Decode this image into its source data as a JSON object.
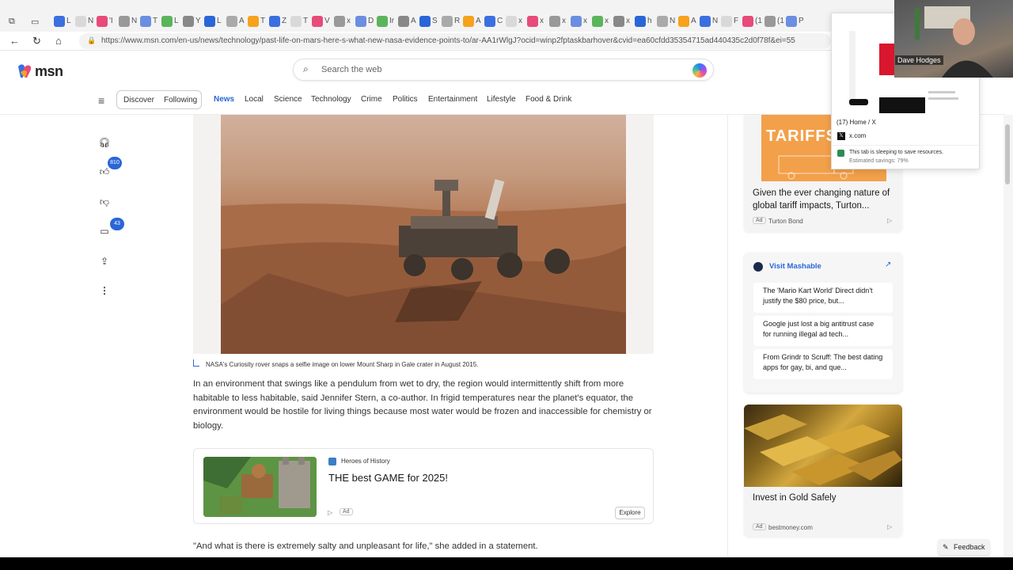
{
  "browser": {
    "url": "https://www.msn.com/en-us/news/technology/past-life-on-mars-here-s-what-new-nasa-evidence-points-to/ar-AA1rWlgJ?ocid=winp2fptaskbarhover&cvid=ea60cfdd35354715ad440435c2d0f78f&ei=55",
    "tab_labels": [
      "L",
      "N",
      "'I",
      "N",
      "T",
      "L",
      "Y",
      "L",
      "A",
      "T",
      "Z",
      "T",
      "V",
      "x",
      "D",
      "Ir",
      "A",
      "S",
      "R",
      "A",
      "C",
      "x",
      "x",
      "x",
      "x",
      "x",
      "x",
      "h",
      "N",
      "A",
      "N",
      "F",
      "(1",
      "(1",
      "P"
    ]
  },
  "header": {
    "logo": "msn",
    "search_placeholder": "Search the web"
  },
  "nav": {
    "pill": [
      "Discover",
      "Following"
    ],
    "items": [
      "News",
      "Local",
      "Science",
      "Technology",
      "Crime",
      "Politics",
      "Entertainment",
      "Lifestyle",
      "Food & Drink"
    ],
    "active": "News"
  },
  "rail": {
    "like_count": "810",
    "comment_count": "43"
  },
  "article": {
    "caption": "NASA's Curiosity rover snaps a selfie image on lower Mount Sharp in Gale crater in August 2015.",
    "para1": "In an environment that swings like a pendulum from wet to dry, the region would intermittently shift from more habitable to less habitable, said Jennifer Stern, a co-author. In frigid temperatures near the planet's equator, the environment would be hostile for living things because most water would be frozen and inaccessible for chemistry or biology.",
    "para2": "\"And what is there is extremely salty and unpleasant for life,\" she added in a statement."
  },
  "ad_card": {
    "source": "Heroes of History",
    "title": "THE best GAME for 2025!",
    "ad_label": "Ad",
    "cta": "Explore"
  },
  "right": {
    "tariff": {
      "image_word": "TARIFFS",
      "title": "Given the ever changing nature of global tariff impacts, Turton...",
      "ad_label": "Ad",
      "source": "Turton Bond"
    },
    "mashable": {
      "title": "Visit Mashable",
      "items": [
        "The 'Mario Kart World' Direct didn't justify the $80 price, but...",
        "Google just lost a big antitrust case for running illegal ad tech...",
        "From Grindr to Scruff: The best dating apps for gay, bi, and que..."
      ]
    },
    "gold": {
      "title": "Invest in Gold Safely",
      "ad_label": "Ad",
      "source": "bestmoney.com"
    }
  },
  "tab_popup": {
    "title": "(17) Home / X",
    "domain": "x.com",
    "sleeping": "This tab is sleeping to save resources.",
    "savings": "Estimated savings: 79%"
  },
  "webcam": {
    "name": "Dave Hodges"
  },
  "feedback": "Feedback",
  "colors": {
    "accent": "#2a66d8",
    "tariff_orange": "#f3a04a"
  }
}
